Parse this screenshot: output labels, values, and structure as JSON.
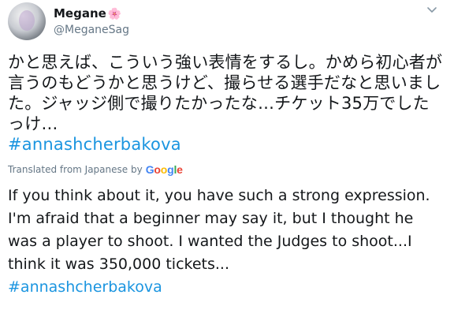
{
  "author": {
    "display_name": "Megane",
    "name_emoji": "🌸",
    "handle": "@MeganeSag"
  },
  "tweet": {
    "text_ja": "かと思えば、こういう強い表情をするし。かめら初心者が言うのもどうかと思うけど、撮らせる選手だなと思いました。ジャッジ側で撮りたかったな…チケット35万でしたっけ…",
    "hashtag_ja": "#annashcherbakova",
    "translated_label": "Translated from Japanese by",
    "translator_letters": [
      "G",
      "o",
      "o",
      "g",
      "l",
      "e"
    ],
    "text_en": "If you think about it, you have such a strong expression. I'm afraid that a beginner may say it, but I thought he was a player to shoot. I wanted the Judges to shoot...I think it was 350,000 tickets...",
    "hashtag_en": "#annashcherbakova"
  },
  "colors": {
    "link": "#1b95e0",
    "muted": "#657786",
    "text": "#14171a"
  },
  "icons": {
    "avatar": "avatar-image",
    "menu": "chevron-down-icon"
  }
}
